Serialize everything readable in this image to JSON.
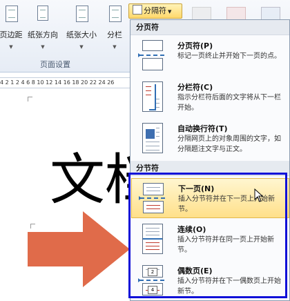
{
  "ribbon": {
    "buttons": [
      {
        "label": "页边距",
        "dropdown": true
      },
      {
        "label": "纸张方向",
        "dropdown": true
      },
      {
        "label": "纸张大小",
        "dropdown": true
      },
      {
        "label": "分栏",
        "dropdown": true
      }
    ],
    "group_label": "页面设置",
    "break_button": {
      "label": "分隔符",
      "icon": "page-break-icon"
    }
  },
  "ruler": {
    "ticks": "4 2 1 2 4 6 8 10 12 14 16 18 20 22 24 26"
  },
  "document": {
    "text": "文档",
    "shape": "right-arrow",
    "arrow_color": "#e06b4a"
  },
  "menu": {
    "sections": [
      {
        "header": "分页符",
        "items": [
          {
            "title": "分页符(P)",
            "desc": "标记一页终止并开始下一页的点。",
            "icon": "page-break-icon"
          },
          {
            "title": "分栏符(C)",
            "desc": "指示分栏符后面的文字将从下一栏开始。",
            "icon": "column-break-icon"
          },
          {
            "title": "自动换行符(T)",
            "desc": "分隔网页上的对象周围的文字，如分隔题注文字与正文。",
            "icon": "text-wrap-icon"
          }
        ]
      },
      {
        "header": "分节符",
        "items": [
          {
            "title": "下一页(N)",
            "desc": "插入分节符并在下一页上开始新节。",
            "icon": "next-page-icon",
            "highlighted": true
          },
          {
            "title": "连续(O)",
            "desc": "插入分节符并在同一页上开始新节。",
            "icon": "continuous-icon"
          },
          {
            "title": "偶数页(E)",
            "desc": "插入分节符并在下一偶数页上开始新节。",
            "icon": "even-page-icon"
          }
        ]
      }
    ]
  },
  "colors": {
    "highlight": "#ffe08a",
    "annotation_frame": "#1010d8",
    "menu_header": "#e6eaf0"
  }
}
